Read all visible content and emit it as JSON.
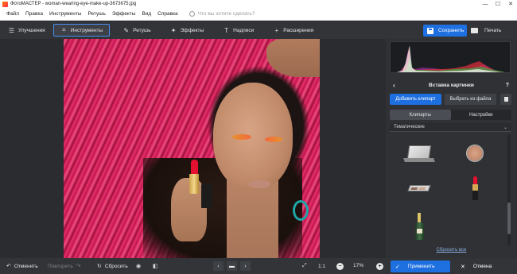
{
  "window": {
    "title": "ФотоМАСТЕР - woman-wearing-eye-make-up-3673675.jpg",
    "minimize": "—",
    "maximize": "☐",
    "close": "✕"
  },
  "menu": {
    "items": [
      "Файл",
      "Правка",
      "Инструменты",
      "Ретушь",
      "Эффекты",
      "Вид",
      "Справка"
    ],
    "search_placeholder": "Что вы хотите сделать?"
  },
  "toolbar": {
    "tools": [
      {
        "label": "Улучшения",
        "icon": "sliders-icon"
      },
      {
        "label": "Инструменты",
        "icon": "crop-icon",
        "active": true
      },
      {
        "label": "Ретушь",
        "icon": "brush-icon"
      },
      {
        "label": "Эффекты",
        "icon": "magic-wand-icon"
      },
      {
        "label": "Надписи",
        "icon": "text-icon"
      },
      {
        "label": "Расширения",
        "icon": "plus-icon"
      }
    ],
    "save_label": "Сохранить",
    "print_label": "Печать"
  },
  "panel": {
    "title": "Вставка картинки",
    "help": "?",
    "add_clipart": "Добавить клипарт",
    "from_file": "Выбрать из файла",
    "tabs": [
      "Клипарты",
      "Настройки"
    ],
    "active_tab": "Клипарты",
    "category": "Тематические",
    "cliparts": [
      "laptop",
      "face-powder",
      "eyeshadow-palette",
      "lipstick",
      "champagne-bottle"
    ],
    "reset_all": "Сбросить все"
  },
  "bottom": {
    "undo": "Отменить",
    "redo": "Повторить",
    "reset": "Сбросить",
    "ratio": "1:1",
    "zoom": "17%",
    "apply": "Применить",
    "cancel": "Отмена"
  },
  "colors": {
    "accent": "#1e6fe0",
    "panel_bg": "#2f3135",
    "toolbar_bg": "#323438"
  }
}
